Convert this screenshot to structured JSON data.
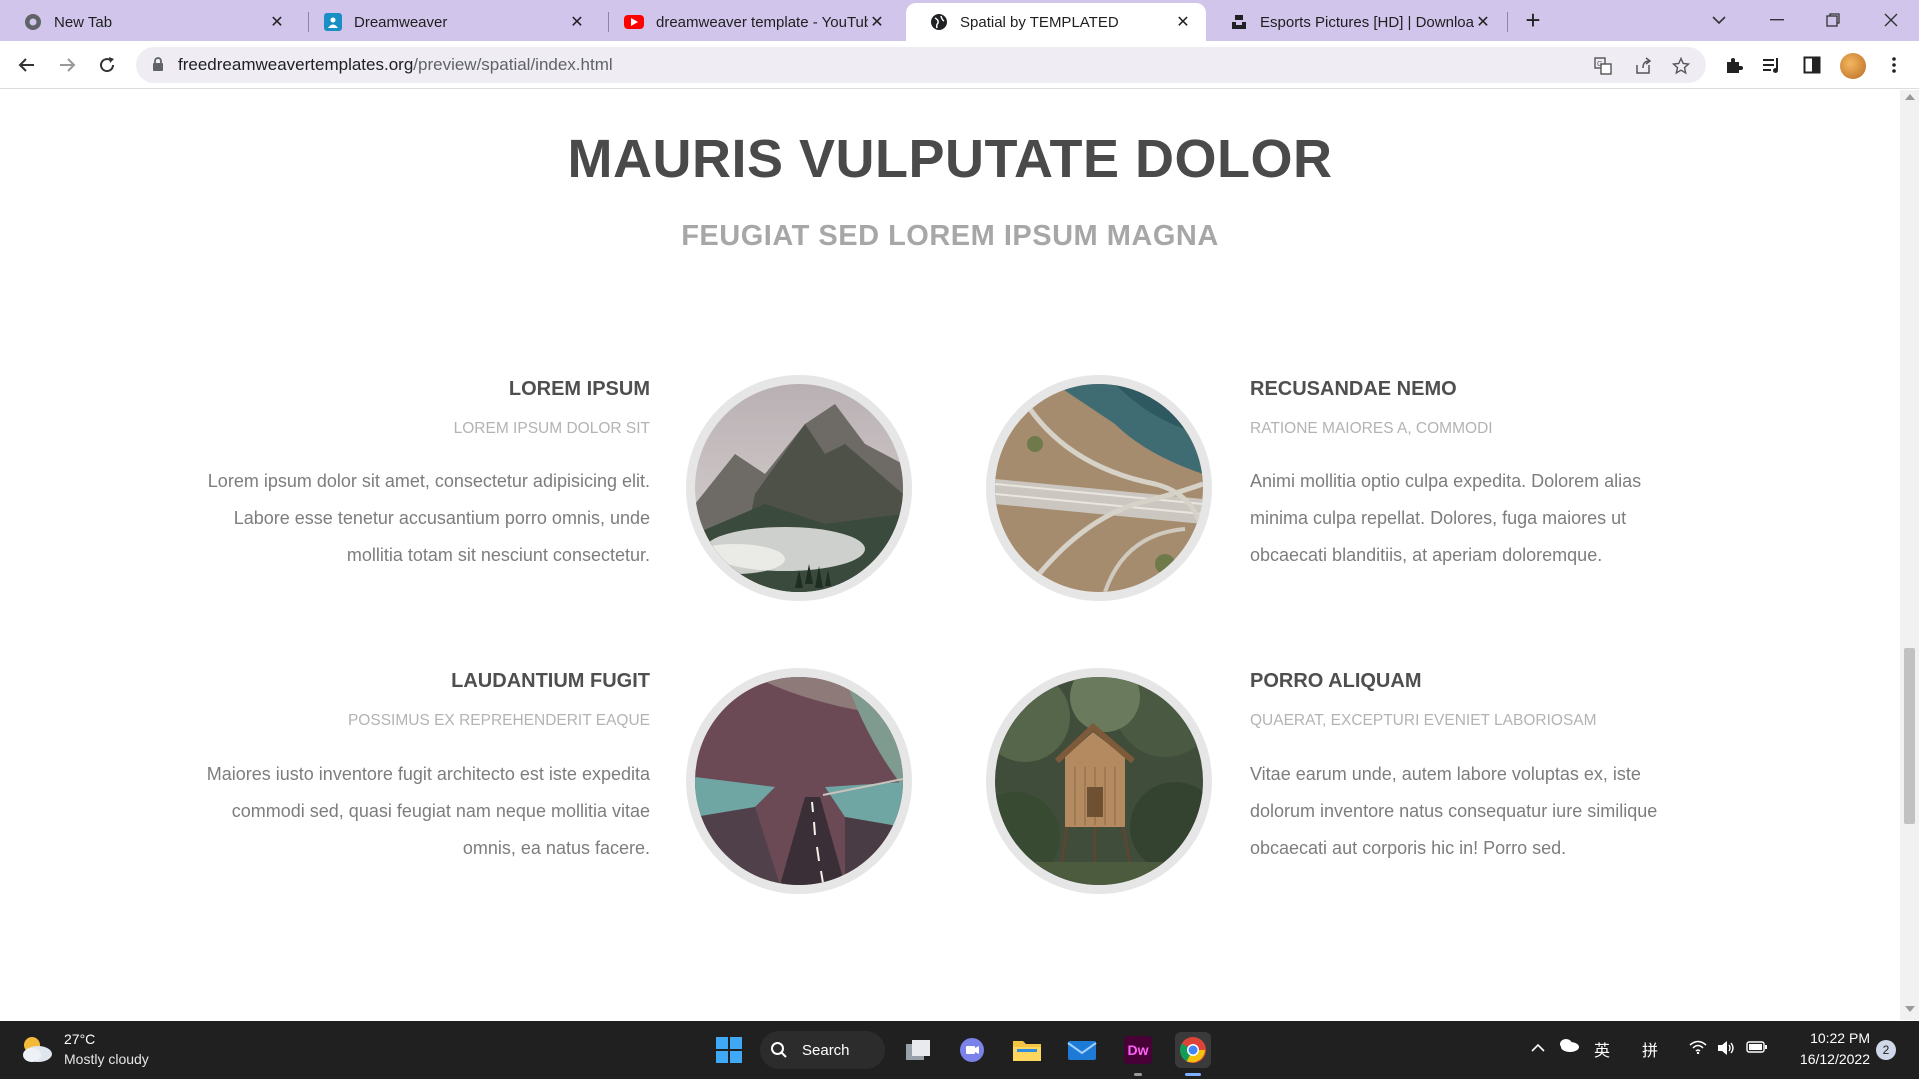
{
  "browser": {
    "tabs": [
      {
        "label": "New Tab"
      },
      {
        "label": "Dreamweaver"
      },
      {
        "label": "dreamweaver template - YouTube"
      },
      {
        "label": "Spatial by TEMPLATED"
      },
      {
        "label": "Esports Pictures [HD] | Download"
      }
    ],
    "active_tab_index": 3,
    "url_host": "freedreamweavertemplates.org",
    "url_path": "/preview/spatial/index.html"
  },
  "page": {
    "title": "MAURIS VULPUTATE DOLOR",
    "subtitle": "FEUGIAT SED LOREM IPSUM MAGNA",
    "features": [
      {
        "title": "LOREM IPSUM",
        "subtitle": "LOREM IPSUM DOLOR SIT",
        "body": "Lorem ipsum dolor sit amet, consectetur adipisicing elit. Labore esse tenetur accusantium porro omnis, unde mollitia totam sit nesciunt consectetur.",
        "image": "mountain-photo"
      },
      {
        "title": "RECUSANDAE NEMO",
        "subtitle": "RATIONE MAIORES A, COMMODI",
        "body": "Animi mollitia optio culpa expedita. Dolorem alias minima culpa repellat. Dolores, fuga maiores ut obcaecati blanditiis, at aperiam doloremque.",
        "image": "highway-interchange-photo"
      },
      {
        "title": "LAUDANTIUM FUGIT",
        "subtitle": "POSSIMUS EX REPREHENDERIT EAQUE",
        "body": "Maiores iusto inventore fugit architecto est iste expedita commodi sed, quasi feugiat nam neque mollitia vitae omnis, ea natus facere.",
        "image": "coastal-road-photo"
      },
      {
        "title": "PORRO ALIQUAM",
        "subtitle": "QUAERAT, EXCEPTURI EVENIET LABORIOSAM",
        "body": "Vitae earum unde, autem labore voluptas ex, iste dolorum inventore natus consequatur iure similique obcaecati aut corporis hic in! Porro sed.",
        "image": "forest-cabin-photo"
      }
    ]
  },
  "taskbar": {
    "weather_temp": "27°C",
    "weather_condition": "Mostly cloudy",
    "search_label": "Search",
    "ime_lang": "英",
    "ime_mode": "拼",
    "time": "10:22 PM",
    "date": "16/12/2022",
    "notification_count": "2",
    "dw_label": "Dw"
  }
}
